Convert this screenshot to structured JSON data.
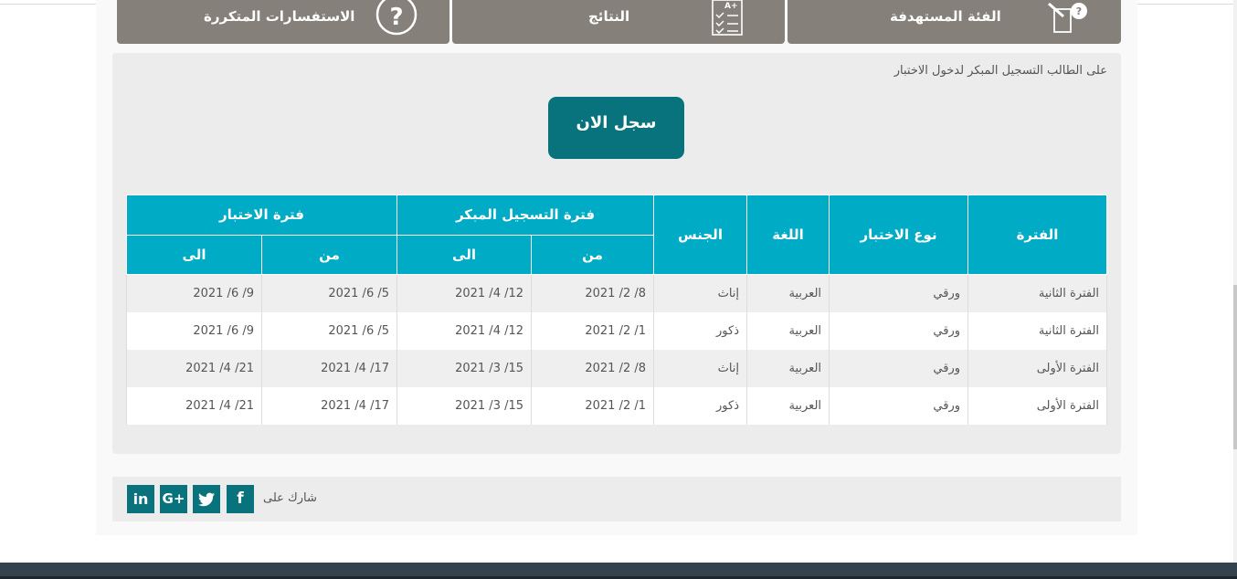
{
  "nav": {
    "faq_label": "الاستفسارات المتكررة",
    "results_label": "النتائج",
    "target_label": "الفئة المستهدفة"
  },
  "panel": {
    "note": "على الطالب التسجيل المبكر لدخول الاختبار",
    "register_label": "سجل الان"
  },
  "table": {
    "headers": {
      "period": "الفترة",
      "test_type": "نوع الاختبار",
      "language": "اللغة",
      "gender": "الجنس",
      "early_registration": "فترة التسجيل المبكر",
      "test_period": "فترة الاختبار",
      "from": "من",
      "to": "الى"
    },
    "rows": [
      {
        "period": "الفترة الثانية",
        "type": "ورقي",
        "language": "العربية",
        "gender": "إناث",
        "reg_from": "2021 /2 /8",
        "reg_to": "2021 /4 /12",
        "test_from": "2021 /6 /5",
        "test_to": "2021 /6 /9"
      },
      {
        "period": "الفترة الثانية",
        "type": "ورقي",
        "language": "العربية",
        "gender": "ذكور",
        "reg_from": "2021 /2 /1",
        "reg_to": "2021 /4 /12",
        "test_from": "2021 /6 /5",
        "test_to": "2021 /6 /9"
      },
      {
        "period": "الفترة الأولى",
        "type": "ورقي",
        "language": "العربية",
        "gender": "إناث",
        "reg_from": "2021 /2 /8",
        "reg_to": "2021 /3 /15",
        "test_from": "2021 /4 /17",
        "test_to": "2021 /4 /21"
      },
      {
        "period": "الفترة الأولى",
        "type": "ورقي",
        "language": "العربية",
        "gender": "ذكور",
        "reg_from": "2021 /2 /1",
        "reg_to": "2021 /3 /15",
        "test_from": "2021 /4 /17",
        "test_to": "2021 /4 /21"
      }
    ]
  },
  "share": {
    "label": "شارك على",
    "facebook_glyph": "f",
    "twitter_icon": "twitter-icon",
    "google_glyph": "G+",
    "linkedin_glyph": "in"
  },
  "colors": {
    "nav_bg": "#858079",
    "header_bg": "#00abc5",
    "button_bg": "#08737d",
    "footer_bg": "#33424d"
  }
}
